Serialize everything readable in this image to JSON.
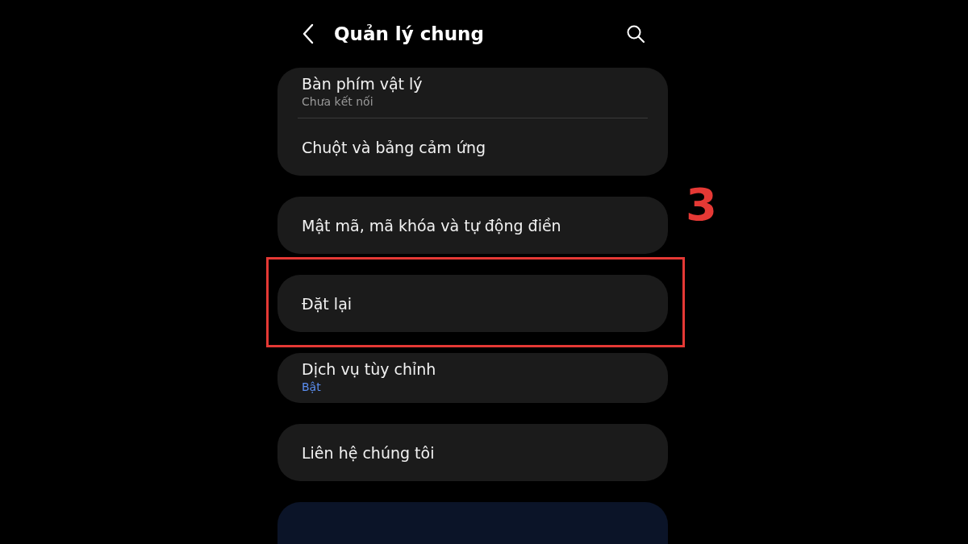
{
  "header": {
    "title": "Quản lý chung"
  },
  "groups": [
    {
      "highlighted": false,
      "items": [
        {
          "title": "Bàn phím vật lý",
          "subtitle": "Chưa kết nối",
          "active": false
        },
        {
          "title": "Chuột và bảng cảm ứng"
        }
      ]
    },
    {
      "highlighted": false,
      "items": [
        {
          "title": "Mật mã, mã khóa và tự động điền"
        }
      ]
    },
    {
      "highlighted": true,
      "annotation": "3",
      "items": [
        {
          "title": "Đặt lại"
        }
      ]
    },
    {
      "highlighted": false,
      "items": [
        {
          "title": "Dịch vụ tùy chỉnh",
          "subtitle": "Bật",
          "active": true
        }
      ]
    },
    {
      "highlighted": false,
      "items": [
        {
          "title": "Liên hệ chúng tôi"
        }
      ]
    }
  ]
}
